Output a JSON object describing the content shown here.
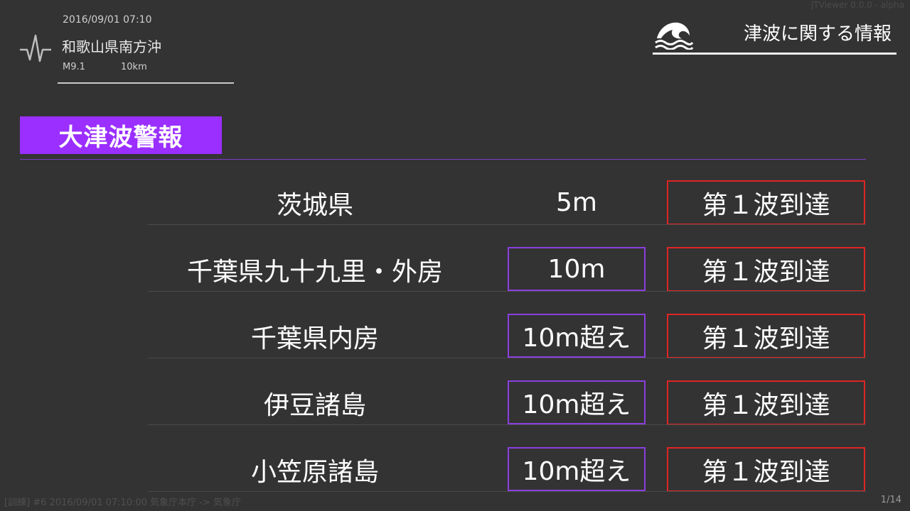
{
  "app": {
    "version_label": "JTViewer 0.0.0 - alpha"
  },
  "earthquake": {
    "datetime": "2016/09/01 07:10",
    "region": "和歌山県南方沖",
    "magnitude": "M9.1",
    "depth": "10km",
    "icon": "seismograph-icon"
  },
  "tsunami_info": {
    "title": "津波に関する情報",
    "icon": "tsunami-wave-icon"
  },
  "warning": {
    "category": "大津波警報",
    "accent_color": "#9a2fff"
  },
  "rows": [
    {
      "area": "茨城県",
      "height": "5m",
      "height_framed": false,
      "arrival": "第１波到達"
    },
    {
      "area": "千葉県九十九里・外房",
      "height": "10m",
      "height_framed": true,
      "arrival": "第１波到達"
    },
    {
      "area": "千葉県内房",
      "height": "10m超え",
      "height_framed": true,
      "arrival": "第１波到達"
    },
    {
      "area": "伊豆諸島",
      "height": "10m超え",
      "height_framed": true,
      "arrival": "第１波到達"
    },
    {
      "area": "小笠原諸島",
      "height": "10m超え",
      "height_framed": true,
      "arrival": "第１波到達"
    }
  ],
  "colors": {
    "background": "#333333",
    "arrival_border": "#e02424",
    "height_border": "#8b3fe0"
  },
  "footer": {
    "source": "[訓練] #6 2016/09/01 07:10:00 気象庁本庁 -> 気象庁",
    "page": "1/14"
  }
}
